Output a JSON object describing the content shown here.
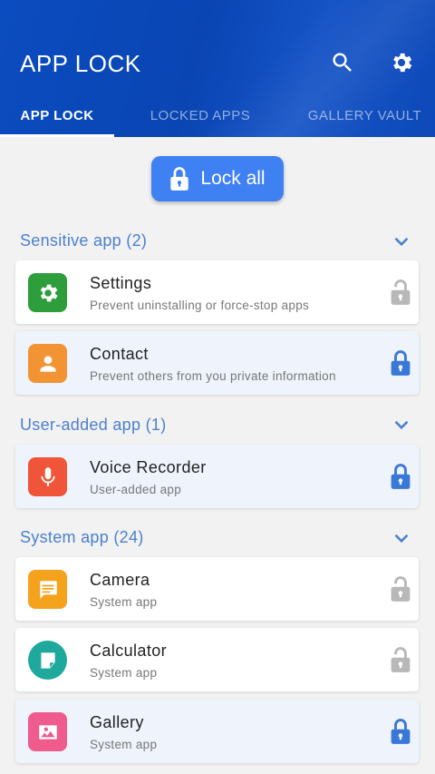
{
  "header": {
    "title": "APP LOCK",
    "search_icon": "search-icon",
    "settings_icon": "gear-icon",
    "tabs": [
      {
        "label": "APP LOCK",
        "active": true
      },
      {
        "label": "LOCKED APPS",
        "active": false
      },
      {
        "label": "GALLERY VAULT",
        "active": false
      }
    ]
  },
  "lock_all": {
    "label": "Lock all",
    "icon": "lock-icon"
  },
  "sections": [
    {
      "title": "Sensitive app (2)",
      "apps": [
        {
          "name": "Settings",
          "desc": "Prevent uninstalling or force-stop apps",
          "locked": false,
          "color": "#2e9e3c",
          "icon": "gear-icon"
        },
        {
          "name": "Contact",
          "desc": "Prevent others from you private information",
          "locked": true,
          "color": "#f29434",
          "icon": "person-icon"
        }
      ]
    },
    {
      "title": "User-added app (1)",
      "apps": [
        {
          "name": "Voice Recorder",
          "desc": "User-added app",
          "locked": true,
          "color": "#f0553a",
          "icon": "microphone-icon"
        }
      ]
    },
    {
      "title": "System app (24)",
      "apps": [
        {
          "name": "Camera",
          "desc": "System app",
          "locked": false,
          "color": "#f5a21c",
          "icon": "message-icon"
        },
        {
          "name": "Calculator",
          "desc": "System app",
          "locked": false,
          "color": "#1fa99d",
          "icon": "note-icon"
        },
        {
          "name": "Gallery",
          "desc": "System app",
          "locked": true,
          "color": "#ef5b8c",
          "icon": "image-icon"
        }
      ]
    }
  ],
  "colors": {
    "accent": "#3f80f2",
    "locked_icon": "#3a78d8",
    "unlocked_icon": "#b8b8b8",
    "section_title": "#4b7fcf"
  }
}
